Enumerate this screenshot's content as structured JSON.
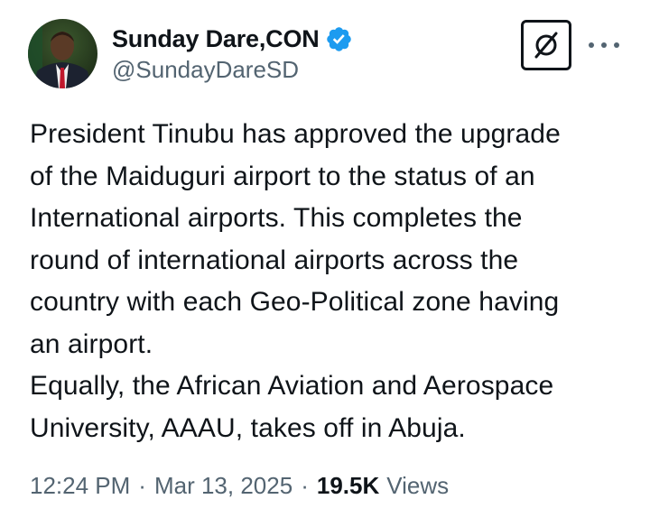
{
  "author": {
    "display_name": "Sunday Dare,CON",
    "handle": "@SundayDareSD",
    "verified": true,
    "verified_color": "#1d9bf0"
  },
  "actions": {
    "grok_icon": "grok-icon",
    "more_icon": "more-icon"
  },
  "tweet": {
    "lines": [
      "President Tinubu has approved the upgrade",
      "of the Maiduguri airport to the status of an",
      "International airports. This completes the",
      "round of international airports across the",
      "country with each Geo-Political zone having",
      "an airport.",
      "Equally, the African Aviation and Aerospace",
      "University, AAAU, takes off in Abuja."
    ]
  },
  "meta": {
    "time": "12:24 PM",
    "separator": "·",
    "date": "Mar 13, 2025",
    "views_count": "19.5K",
    "views_label": "Views"
  }
}
